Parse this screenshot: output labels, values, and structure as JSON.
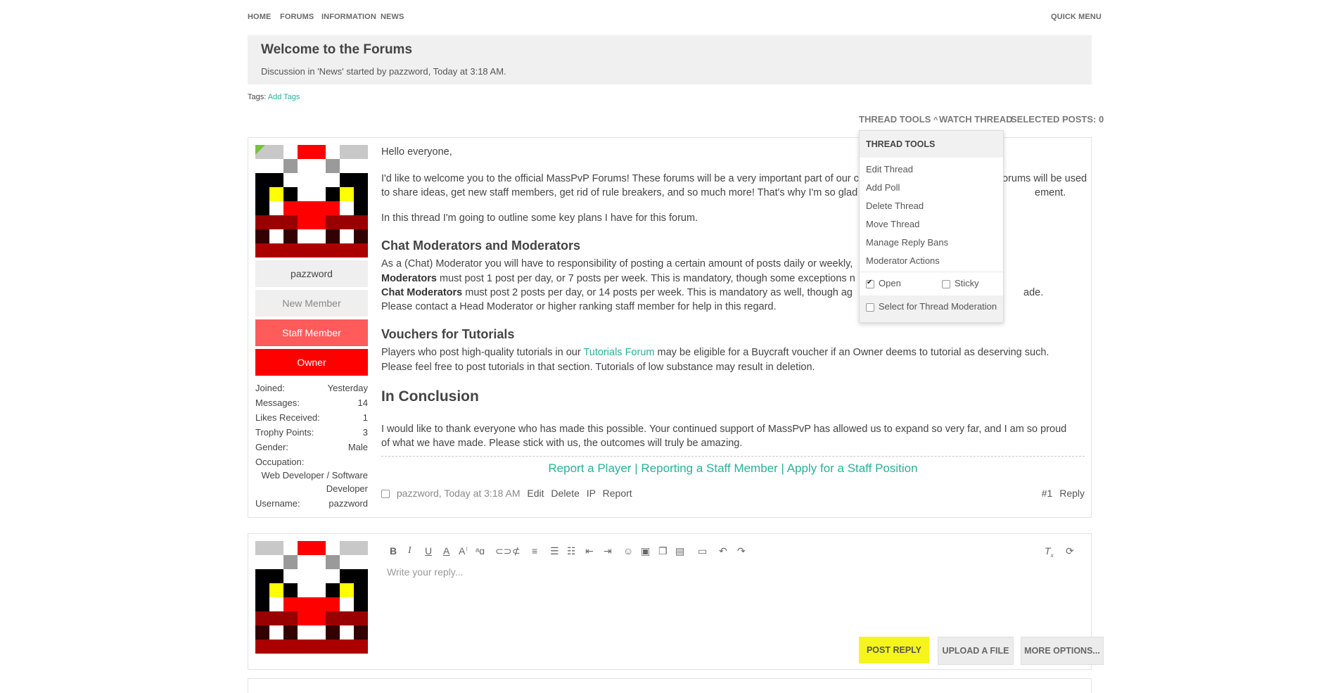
{
  "nav": {
    "home": "Home",
    "forums": "Forums",
    "information": "Information",
    "news": "News",
    "quick_menu": "Quick Menu"
  },
  "thread": {
    "title": "Welcome to the Forums",
    "subtitle": "Discussion in 'News' started by pazzword, Today at 3:18 AM.",
    "tags_label": "Tags:",
    "add_tags": "Add Tags"
  },
  "tools_bar": {
    "thread_tools": "Thread Tools",
    "watch_thread": "Watch Thread",
    "selected_posts": "Selected Posts: 0"
  },
  "dropdown": {
    "header": "Thread Tools",
    "items": [
      "Edit Thread",
      "Add Poll",
      "Delete Thread",
      "Move Thread",
      "Manage Reply Bans",
      "Moderator Actions"
    ],
    "open_label": "Open",
    "sticky_label": "Sticky",
    "select_label": "Select for Thread Moderation"
  },
  "user": {
    "name": "pazzword",
    "rank": "New Member",
    "staff_badge": "Staff Member",
    "owner_badge": "Owner",
    "stats": [
      {
        "k": "Joined:",
        "v": "Yesterday"
      },
      {
        "k": "Messages:",
        "v": "14"
      },
      {
        "k": "Likes Received:",
        "v": "1"
      },
      {
        "k": "Trophy Points:",
        "v": "3"
      },
      {
        "k": "Gender:",
        "v": "Male"
      }
    ],
    "occupation_label": "Occupation:",
    "occupation_line1": "Web Developer / Software",
    "occupation_line2": "Developer",
    "username_label": "Username:",
    "username_value": "pazzword"
  },
  "post": {
    "greeting": "Hello everyone,",
    "intro1": "I'd like to welcome you to the official MassPvP Forums! These forums will be a very important part of our co",
    "intro1_tail": "orums will be used",
    "intro2": "to share ideas, get new staff members, get rid of rule breakers, and so much more! That's why I'm so glad t",
    "intro2_tail": "ement.",
    "outline": "In this thread I'm going to outline some key plans I have for this forum.",
    "h_moderators": "Chat Moderators and Moderators",
    "mod_line1": "As a (Chat) Moderator you will have to responsibility of posting a certain amount of posts daily or weekly,",
    "mod_line2_bold": "Moderators",
    "mod_line2": "must post 1 post per day, or 7 posts per week. This is mandatory, though some exceptions n",
    "mod_line3_bold": "Chat Moderators",
    "mod_line3": "must post 2 posts per day, or 14 posts per week. This is mandatory as well, though ag",
    "mod_line3_tail": "ade.",
    "mod_line4": "Please contact a Head Moderator or higher ranking staff member for help in this regard.",
    "h_vouchers": "Vouchers for Tutorials",
    "vouch_pre": "Players who post high-quality tutorials in our",
    "vouch_link": "Tutorials Forum",
    "vouch_post": "may be eligible for a Buycraft voucher if an Owner deems to tutorial as deserving such.",
    "vouch_line2": "Please feel free to post tutorials in that section. Tutorials of low substance may result in deletion.",
    "h_conclusion": "In Conclusion",
    "concl1": "I would like to thank everyone who has made this possible. Your continued support of MassPvP has allowed us to expand so very far, and I am so proud",
    "concl2": "of what we have made. Please stick with us, the outcomes will truly be amazing.",
    "sig_report": "Report a Player",
    "sig_sep": "|",
    "sig_staff": "Reporting a Staff Member",
    "sig_apply": "Apply for a Staff Position",
    "meta_author": "pazzword, Today at 3:18 AM",
    "edit": "Edit",
    "delete": "Delete",
    "ip": "IP",
    "report": "Report",
    "number": "#1",
    "reply": "Reply"
  },
  "reply_box": {
    "placeholder": "Write your reply...",
    "post_reply": "Post Reply",
    "upload": "Upload a File",
    "more": "More Options...",
    "accent": "#f5f51d"
  },
  "colors": {
    "link": "#2bb09a",
    "staff": "#ff5b5b",
    "owner": "#ff0000"
  }
}
